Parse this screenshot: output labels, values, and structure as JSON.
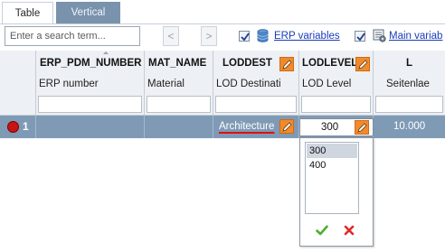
{
  "tabs": [
    {
      "label": "Table",
      "active": true
    },
    {
      "label": "Vertical",
      "active": false
    }
  ],
  "toolbar": {
    "search_placeholder": "Enter a search term...",
    "prev_label": "<",
    "next_label": ">",
    "erp_variables_label": "ERP variables",
    "erp_variables_checked": true,
    "main_variables_label": "Main variab",
    "main_variables_checked": true
  },
  "columns": [
    {
      "key": "ERP_PDM_NUMBER",
      "title": "ERP_PDM_NUMBER",
      "subtitle": "ERP number",
      "editable": false
    },
    {
      "key": "MAT_NAME",
      "title": "MAT_NAME",
      "subtitle": "Material",
      "editable": false
    },
    {
      "key": "LODDEST",
      "title": "LODDEST",
      "subtitle": "LOD Destinati",
      "editable": true
    },
    {
      "key": "LODLEVEL",
      "title": "LODLEVEL",
      "subtitle": "LOD Level",
      "editable": true
    },
    {
      "key": "L",
      "title": "L",
      "subtitle": "Seitenlae",
      "editable": false
    }
  ],
  "row": {
    "number": "1",
    "status_color": "#c81414",
    "cells": {
      "ERP_PDM_NUMBER": "",
      "MAT_NAME": "",
      "LODDEST": "Architecture",
      "LODLEVEL": "300",
      "L": "10.000"
    }
  },
  "dropdown": {
    "options": [
      "300",
      "400"
    ],
    "selected": "300"
  },
  "colors": {
    "row_background": "#7f9ab5",
    "edit_button": "#f08a2c",
    "link": "#1a3cb8",
    "ok": "#4fae2e",
    "cancel": "#e02a2a"
  }
}
